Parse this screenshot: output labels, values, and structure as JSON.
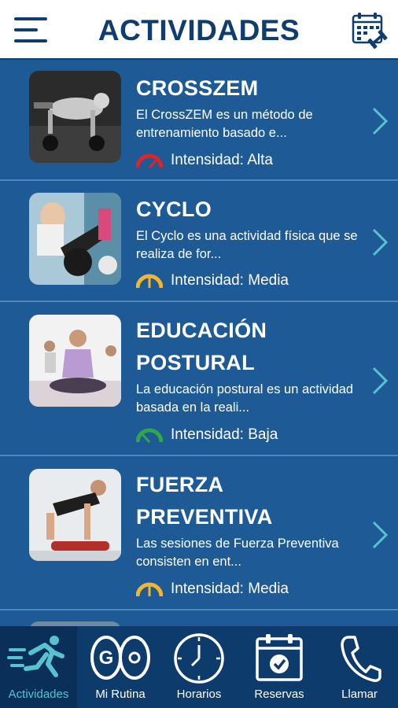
{
  "header": {
    "title": "ACTIVIDADES"
  },
  "activities": [
    {
      "name": "CROSSZEM",
      "description": "El CrossZEM es un método de entrenamiento basado e...",
      "intensity_label": "Intensidad: Alta",
      "intensity_color": "#d8262b"
    },
    {
      "name": "CYCLO",
      "description": "El Cyclo es una actividad física que se realiza de for...",
      "intensity_label": "Intensidad: Media",
      "intensity_color": "#f2b52c"
    },
    {
      "name": "EDUCACIÓN POSTURAL",
      "description": "La educación postural es un actividad  basada en la reali...",
      "intensity_label": "Intensidad: Baja",
      "intensity_color": "#2fa84a"
    },
    {
      "name": "FUERZA PREVENTIVA",
      "description": "Las sesiones de Fuerza Preventiva consisten en ent...",
      "intensity_label": "Intensidad: Media",
      "intensity_color": "#f2b52c"
    }
  ],
  "bottom_nav": [
    {
      "label": "Actividades",
      "icon": "running-icon",
      "active": true
    },
    {
      "label": "Mi Rutina",
      "icon": "weights-icon",
      "active": false
    },
    {
      "label": "Horarios",
      "icon": "clock-icon",
      "active": false
    },
    {
      "label": "Reservas",
      "icon": "calendar-check-icon",
      "active": false
    },
    {
      "label": "Llamar",
      "icon": "phone-icon",
      "active": false
    }
  ],
  "colors": {
    "background": "#1e5b96",
    "header_text": "#0f3d6e",
    "nav_background": "#0d3b6b",
    "accent": "#57c3cf"
  }
}
